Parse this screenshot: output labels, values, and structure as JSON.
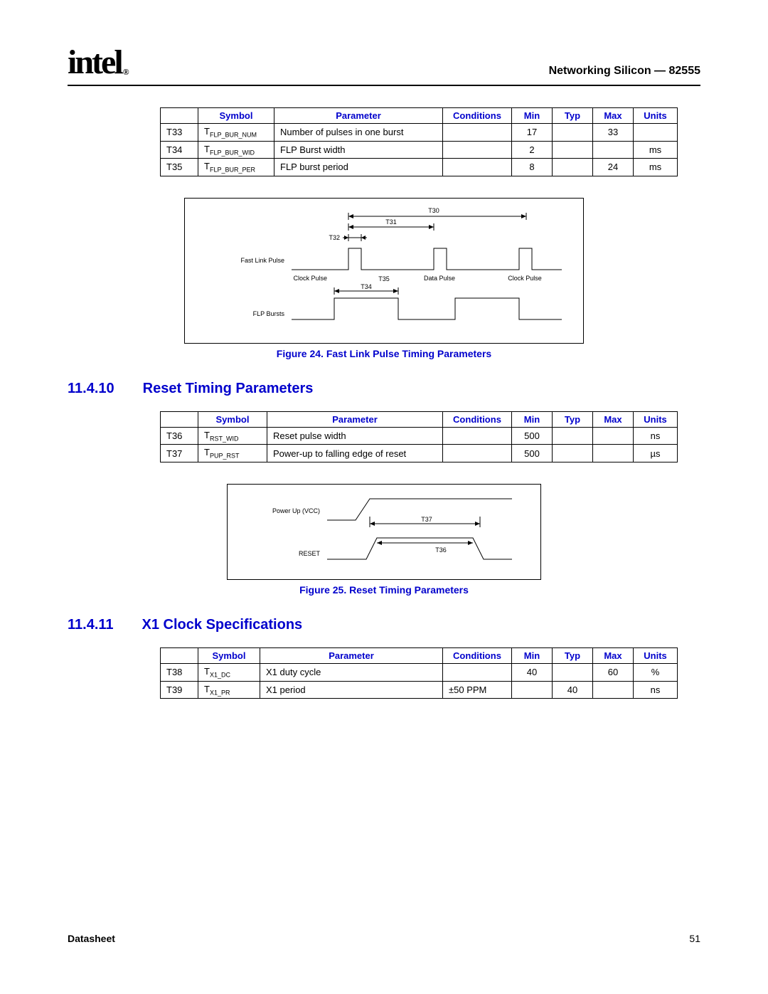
{
  "header": {
    "logo_text": "intel",
    "doc_title": "Networking Silicon — 82555"
  },
  "table1": {
    "headers": [
      "",
      "Symbol",
      "Parameter",
      "Conditions",
      "Min",
      "Typ",
      "Max",
      "Units"
    ],
    "rows": [
      {
        "id": "T33",
        "sym_main": "T",
        "sym_sub": "FLP_BUR_NUM",
        "param": "Number of pulses in one burst",
        "cond": "",
        "min": "17",
        "typ": "",
        "max": "33",
        "units": ""
      },
      {
        "id": "T34",
        "sym_main": "T",
        "sym_sub": "FLP_BUR_WID",
        "param": "FLP Burst width",
        "cond": "",
        "min": "2",
        "typ": "",
        "max": "",
        "units": "ms"
      },
      {
        "id": "T35",
        "sym_main": "T",
        "sym_sub": "FLP_BUR_PER",
        "param": "FLP burst period",
        "cond": "",
        "min": "8",
        "typ": "",
        "max": "24",
        "units": "ms"
      }
    ]
  },
  "figure24": {
    "caption": "Figure 24. Fast Link Pulse Timing Parameters",
    "labels": {
      "t30": "T30",
      "t31": "T31",
      "t32": "T32",
      "t34": "T34",
      "t35": "T35",
      "flp": "Fast Link Pulse",
      "clockpulse": "Clock Pulse",
      "datapulse": "Data Pulse",
      "flpbursts": "FLP Bursts"
    }
  },
  "section1": {
    "num": "11.4.10",
    "title": "Reset Timing Parameters"
  },
  "table2": {
    "headers": [
      "",
      "Symbol",
      "Parameter",
      "Conditions",
      "Min",
      "Typ",
      "Max",
      "Units"
    ],
    "rows": [
      {
        "id": "T36",
        "sym_main": "T",
        "sym_sub": "RST_WID",
        "param": "Reset pulse width",
        "cond": "",
        "min": "500",
        "typ": "",
        "max": "",
        "units": "ns"
      },
      {
        "id": "T37",
        "sym_main": "T",
        "sym_sub": "PUP_RST",
        "param": "Power-up to falling edge of reset",
        "cond": "",
        "min": "500",
        "typ": "",
        "max": "",
        "units": "µs"
      }
    ]
  },
  "figure25": {
    "caption": "Figure 25. Reset Timing Parameters",
    "labels": {
      "powerup": "Power Up (VCC)",
      "reset": "RESET",
      "t36": "T36",
      "t37": "T37"
    }
  },
  "section2": {
    "num": "11.4.11",
    "title": "X1 Clock Specifications"
  },
  "table3": {
    "headers": [
      "",
      "Symbol",
      "Parameter",
      "Conditions",
      "Min",
      "Typ",
      "Max",
      "Units"
    ],
    "rows": [
      {
        "id": "T38",
        "sym_main": "T",
        "sym_sub": "X1_DC",
        "param": "X1 duty cycle",
        "cond": "",
        "min": "40",
        "typ": "",
        "max": "60",
        "units": "%"
      },
      {
        "id": "T39",
        "sym_main": "T",
        "sym_sub": "X1_PR",
        "param": "X1 period",
        "cond": "±50 PPM",
        "min": "",
        "typ": "40",
        "max": "",
        "units": "ns"
      }
    ]
  },
  "footer": {
    "label": "Datasheet",
    "page": "51"
  }
}
